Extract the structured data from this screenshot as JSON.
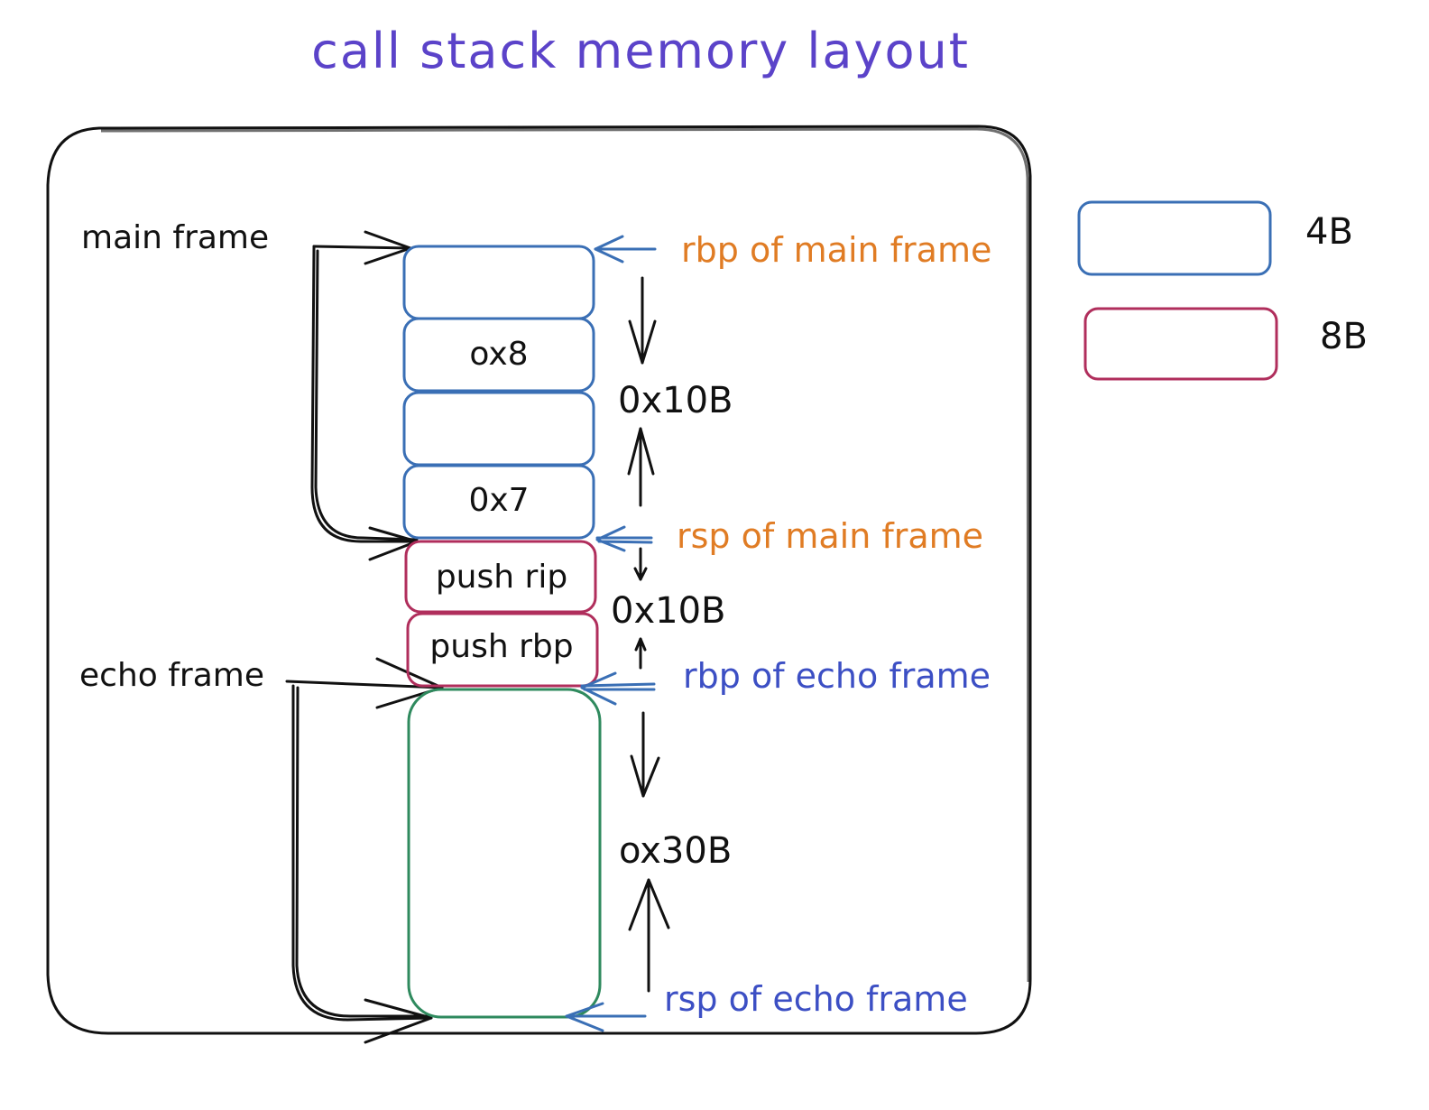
{
  "title": "call stack memory layout",
  "colors": {
    "title": "#5b43c9",
    "slot_4b": "#3a6fb5",
    "slot_8b": "#b02e5c",
    "echo_locals": "#2f8a5e",
    "main_pointer_labels": "#e07c24",
    "echo_pointer_labels": "#3c4fc4",
    "ink": "#111111"
  },
  "frame_labels": {
    "main": "main frame",
    "echo": "echo frame"
  },
  "stack_cells": [
    {
      "label": "",
      "size": "4B",
      "frame": "main"
    },
    {
      "label": "ox8",
      "size": "4B",
      "frame": "main"
    },
    {
      "label": "",
      "size": "4B",
      "frame": "main"
    },
    {
      "label": "0x7",
      "size": "4B",
      "frame": "main"
    },
    {
      "label": "push rip",
      "size": "8B",
      "frame": "call"
    },
    {
      "label": "push rbp",
      "size": "8B",
      "frame": "call"
    },
    {
      "label": "",
      "size": "0x30B",
      "frame": "echo"
    }
  ],
  "pointer_labels": {
    "rbp_main": "rbp of main frame",
    "rsp_main": "rsp of main frame",
    "rbp_echo": "rbp of echo frame",
    "rsp_echo": "rsp of echo frame"
  },
  "size_labels": {
    "main_frame": "0x10B",
    "call_overhead": "0x10B",
    "echo_frame": "ox30B"
  },
  "legend": [
    {
      "label": "4B",
      "color": "#3a6fb5"
    },
    {
      "label": "8B",
      "color": "#b02e5c"
    }
  ]
}
